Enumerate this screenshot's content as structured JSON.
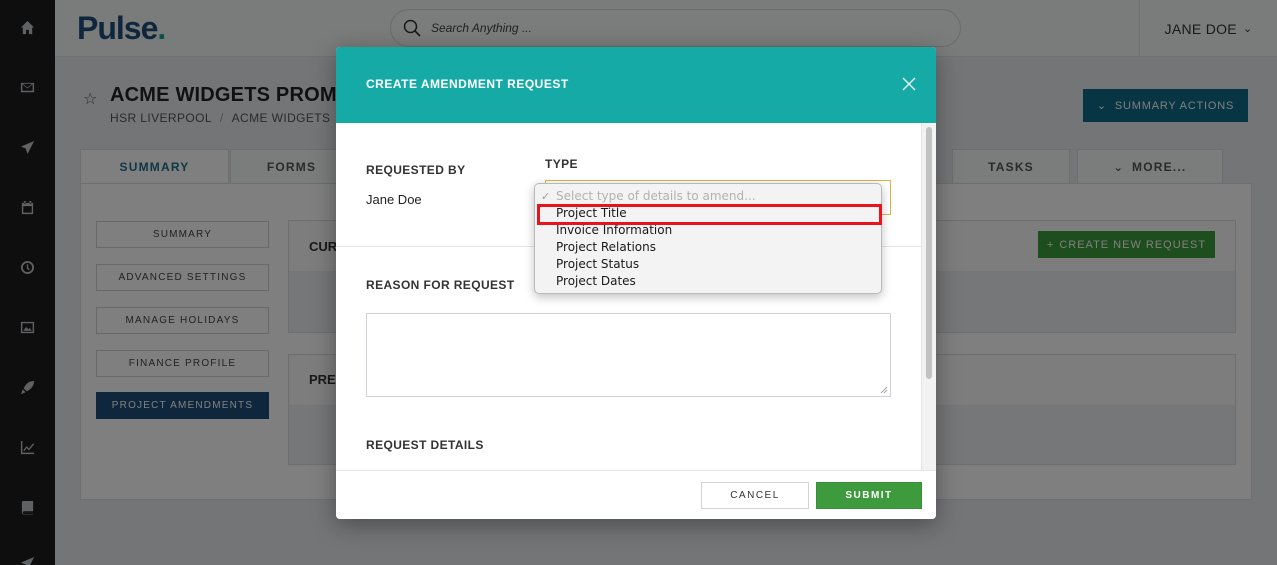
{
  "app": {
    "logo": "Pulse",
    "logo_dot": "."
  },
  "search": {
    "placeholder": "Search Anything ..."
  },
  "user": {
    "name": "JANE DOE"
  },
  "rail_icons": [
    "home-icon",
    "mail-icon",
    "send-icon",
    "calendar-icon",
    "clock-icon",
    "image-icon",
    "rocket-icon",
    "chart-icon",
    "book-icon",
    "send-icon-2"
  ],
  "page": {
    "title": "ACME WIDGETS PROMO",
    "breadcrumb": [
      "HSR LIVERPOOL",
      "ACME WIDGETS"
    ],
    "summary_actions": "SUMMARY ACTIONS"
  },
  "tabs": [
    "SUMMARY",
    "FORMS",
    "TASKS",
    "MORE..."
  ],
  "side_menu": [
    "SUMMARY",
    "ADVANCED SETTINGS",
    "MANAGE HOLIDAYS",
    "FINANCE PROFILE",
    "PROJECT AMENDMENTS"
  ],
  "current_section": {
    "title": "CUR",
    "button": "CREATE NEW REQUEST"
  },
  "previous_section": {
    "title": "PREV"
  },
  "modal": {
    "title": "CREATE AMENDMENT REQUEST",
    "requested_by_label": "REQUESTED BY",
    "requested_by_value": "Jane Doe",
    "type_label": "TYPE",
    "reason_label": "REASON FOR REQUEST",
    "details_label": "REQUEST DETAILS",
    "cancel": "CANCEL",
    "submit": "SUBMIT"
  },
  "dropdown": {
    "placeholder": "Select type of details to amend...",
    "options": [
      "Project Title",
      "Invoice Information",
      "Project Relations",
      "Project Status",
      "Project Dates"
    ],
    "highlighted": "Project Title"
  },
  "colors": {
    "modal_header": "#16aaa6",
    "submit": "#3d9a3d",
    "highlight": "#e8141b",
    "brand": "#1f4e79"
  }
}
